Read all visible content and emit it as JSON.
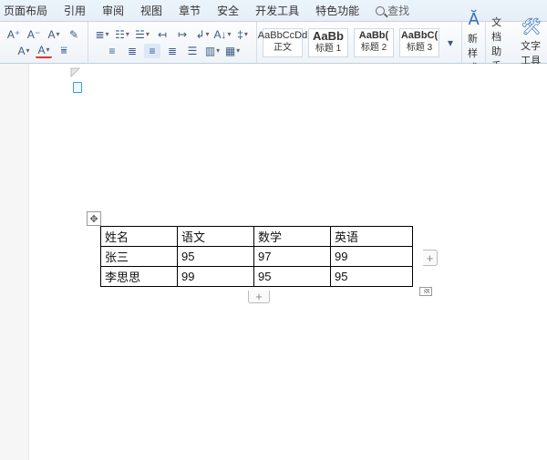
{
  "tabs": {
    "layout": "页面布局",
    "reference": "引用",
    "review": "审阅",
    "view": "视图",
    "section": "章节",
    "security": "安全",
    "dev": "开发工具",
    "special": "特色功能",
    "search": "查找"
  },
  "styles": {
    "s1_sample": "AaBbCcDd",
    "s1_label": "正文",
    "s2_sample": "AaBb",
    "s2_label": "标题 1",
    "s3_sample": "AaBb(",
    "s3_label": "标题 2",
    "s4_sample": "AaBbC(",
    "s4_label": "标题 3"
  },
  "right_tools": {
    "newstyle": "新样式",
    "dochelper": "文档助手",
    "texttool": "文字工具"
  },
  "table": {
    "h1": "姓名",
    "h2": "语文",
    "h3": "数学",
    "h4": "英语",
    "r1c1": "张三",
    "r1c2": "95",
    "r1c3": "97",
    "r1c4": "99",
    "r2c1": "李思思",
    "r2c2": "99",
    "r2c3": "95",
    "r2c4": "95"
  },
  "handles": {
    "plus": "+",
    "move": "✥"
  }
}
